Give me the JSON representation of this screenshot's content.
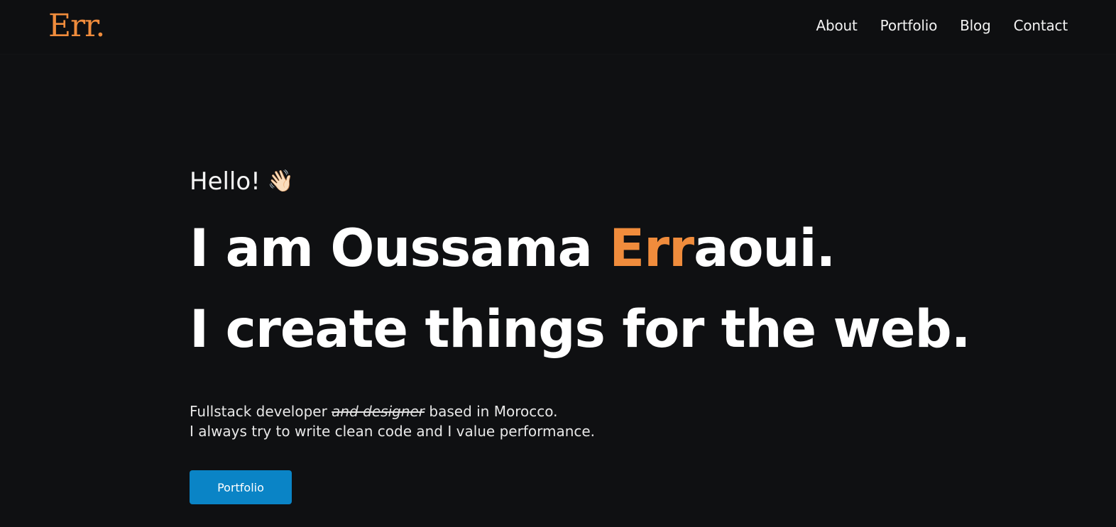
{
  "header": {
    "logo": "Err.",
    "nav": [
      {
        "label": "About"
      },
      {
        "label": "Portfolio"
      },
      {
        "label": "Blog"
      },
      {
        "label": "Contact"
      }
    ]
  },
  "hero": {
    "greeting": "Hello!",
    "greeting_emoji": "👋🏻",
    "headline_prefix": "I am Oussama ",
    "headline_accent": "Err",
    "headline_suffix": "aoui.",
    "subheadline": "I create things for the web.",
    "description_line1_start": "Fullstack developer ",
    "description_line1_struck": "and designer",
    "description_line1_end": " based in Morocco.",
    "description_line2": "I always try to write clean code and I value performance.",
    "cta_label": "Portfolio"
  },
  "colors": {
    "background": "#0f1012",
    "accent": "#f08c3c",
    "button": "#0a84c6",
    "text": "#ffffff"
  }
}
